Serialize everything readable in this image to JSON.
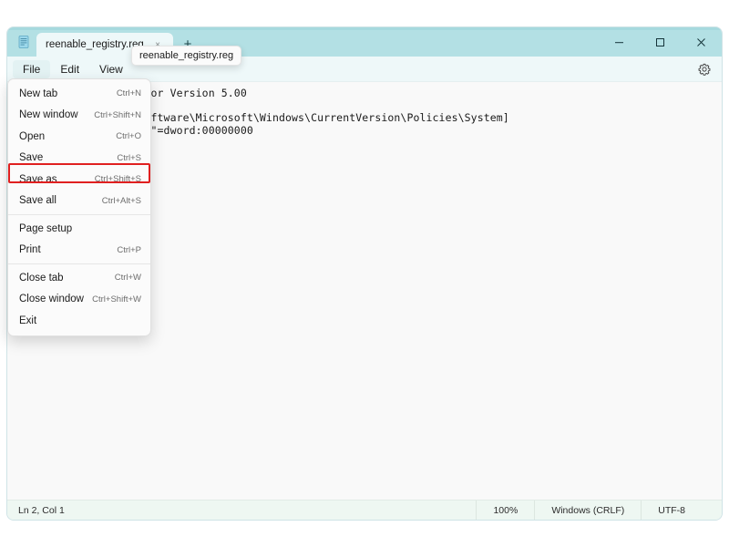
{
  "window": {
    "app_name": "Notepad",
    "tab": {
      "icon": "notepad-document-icon",
      "label": "reenable_registry.reg",
      "close_glyph": "×"
    },
    "new_tab_glyph": "+",
    "caption": {
      "minimize_label": "Minimize",
      "maximize_label": "Maximize",
      "close_label": "Close"
    }
  },
  "tooltip": {
    "text": "reenable_registry.reg"
  },
  "menubar": {
    "items": [
      {
        "label": "File",
        "active": true
      },
      {
        "label": "Edit",
        "active": false
      },
      {
        "label": "View",
        "active": false
      }
    ],
    "settings_icon": "gear-icon"
  },
  "file_menu": {
    "groups": [
      {
        "items": [
          {
            "label": "New tab",
            "accel": "Ctrl+N",
            "highlighted": false
          },
          {
            "label": "New window",
            "accel": "Ctrl+Shift+N",
            "highlighted": false
          },
          {
            "label": "Open",
            "accel": "Ctrl+O",
            "highlighted": false
          },
          {
            "label": "Save",
            "accel": "Ctrl+S",
            "highlighted": false
          },
          {
            "label": "Save as",
            "accel": "Ctrl+Shift+S",
            "highlighted": true
          },
          {
            "label": "Save all",
            "accel": "Ctrl+Alt+S",
            "highlighted": false
          }
        ]
      },
      {
        "items": [
          {
            "label": "Page setup",
            "accel": "",
            "highlighted": false
          },
          {
            "label": "Print",
            "accel": "Ctrl+P",
            "highlighted": false
          }
        ]
      },
      {
        "items": [
          {
            "label": "Close tab",
            "accel": "Ctrl+W",
            "highlighted": false
          },
          {
            "label": "Close window",
            "accel": "Ctrl+Shift+W",
            "highlighted": false
          },
          {
            "label": "Exit",
            "accel": "",
            "highlighted": false
          }
        ]
      }
    ],
    "highlight_color": "#e02020"
  },
  "editor": {
    "content": "Windows Registry Editor Version 5.00\n\n[HKEY_CURRENT_USER\\Software\\Microsoft\\Windows\\CurrentVersion\\Policies\\System]\n\"DisableRegistryTools\"=dword:00000000"
  },
  "statusbar": {
    "position": "Ln 2, Col 1",
    "zoom": "100%",
    "line_ending": "Windows (CRLF)",
    "encoding": "UTF-8"
  }
}
